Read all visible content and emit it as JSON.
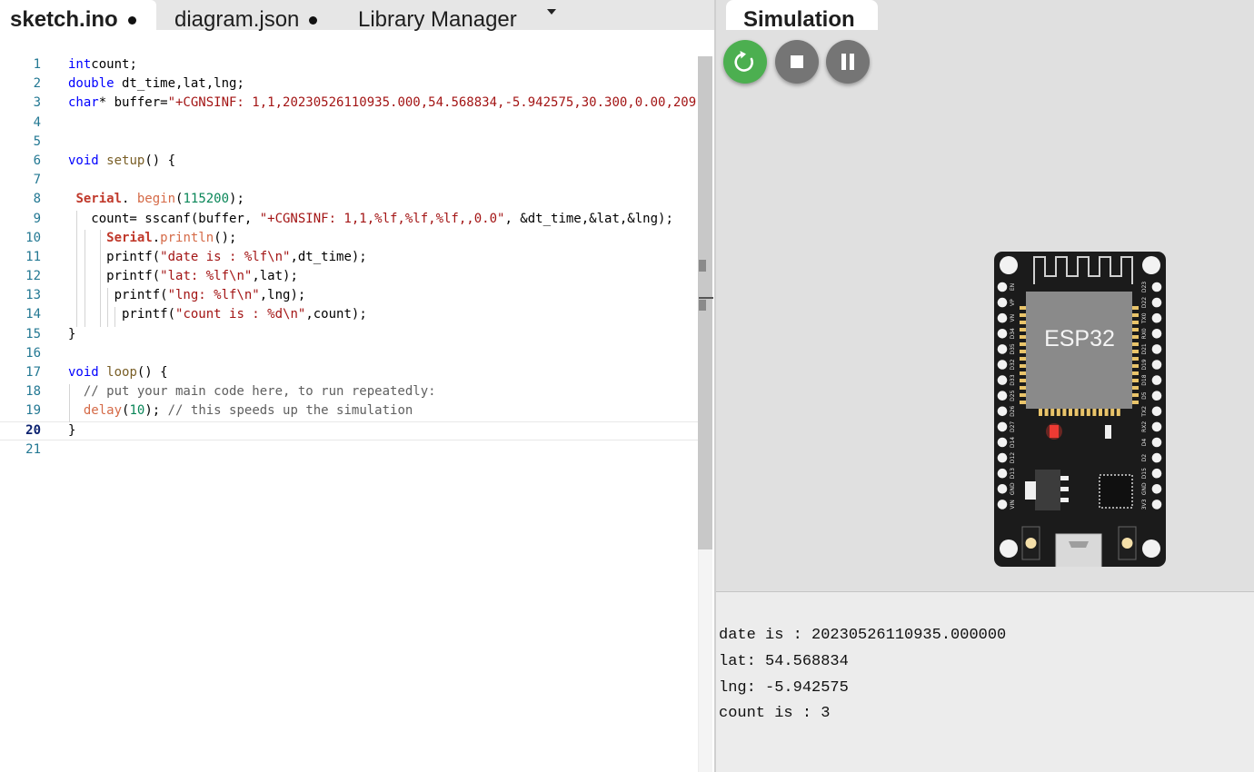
{
  "tabs": {
    "sketch": "sketch.ino",
    "diagram": "diagram.json",
    "library": "Library Manager"
  },
  "simulation": {
    "tab_label": "Simulation",
    "controls": [
      "restart-icon",
      "stop-icon",
      "pause-icon"
    ],
    "board_label": "ESP32",
    "left_pins": [
      "EN",
      "VP",
      "VN",
      "D34",
      "D35",
      "D32",
      "D33",
      "D25",
      "D26",
      "D27",
      "D14",
      "D12",
      "D13",
      "GND",
      "VIN"
    ],
    "right_pins": [
      "D23",
      "D22",
      "TX0",
      "RX0",
      "D21",
      "D19",
      "D18",
      "D5",
      "TX2",
      "RX2",
      "D4",
      "D2",
      "D15",
      "GND",
      "3V3"
    ],
    "serial_output": [
      "date is : 20230526110935.000000",
      "lat: 54.568834",
      "lng: -5.942575",
      "count is : 3"
    ]
  },
  "editor": {
    "current_line": 20,
    "lines": [
      {
        "n": "1",
        "t": [
          [
            "kw",
            "int"
          ],
          [
            "",
            "count;"
          ]
        ]
      },
      {
        "n": "2",
        "t": [
          [
            "kw",
            "double"
          ],
          [
            "",
            " dt_time,lat,lng;"
          ]
        ]
      },
      {
        "n": "3",
        "t": [
          [
            "kw",
            "char"
          ],
          [
            "",
            "* buffer="
          ],
          [
            "str",
            "\"+CGNSINF: 1,1,20230526110935.000,54.568834,-5.942575,30.300,0.00,209."
          ]
        ]
      },
      {
        "n": "4",
        "t": []
      },
      {
        "n": "5",
        "t": []
      },
      {
        "n": "6",
        "t": [
          [
            "kw",
            "void"
          ],
          [
            "",
            " "
          ],
          [
            "fn",
            "setup"
          ],
          [
            "",
            "() {"
          ]
        ]
      },
      {
        "n": "7",
        "t": []
      },
      {
        "n": "8",
        "t": [
          [
            "",
            " "
          ],
          [
            "obj",
            "Serial"
          ],
          [
            "",
            ". "
          ],
          [
            "fnc",
            "begin"
          ],
          [
            "",
            "("
          ],
          [
            "num",
            "115200"
          ],
          [
            "",
            ");"
          ]
        ]
      },
      {
        "n": "9",
        "t": [
          [
            "",
            "   count= sscanf(buffer, "
          ],
          [
            "str",
            "\"+CGNSINF: 1,1,%lf,%lf,%lf,,0.0\""
          ],
          [
            "",
            ", &dt_time,&lat,&lng);"
          ]
        ]
      },
      {
        "n": "10",
        "t": [
          [
            "",
            "     "
          ],
          [
            "obj",
            "Serial"
          ],
          [
            "",
            "."
          ],
          [
            "fnc",
            "println"
          ],
          [
            "",
            "();"
          ]
        ]
      },
      {
        "n": "11",
        "t": [
          [
            "",
            "     printf("
          ],
          [
            "str",
            "\"date is : %lf\\n\""
          ],
          [
            "",
            ",dt_time);"
          ]
        ]
      },
      {
        "n": "12",
        "t": [
          [
            "",
            "     printf("
          ],
          [
            "str",
            "\"lat: %lf\\n\""
          ],
          [
            "",
            ",lat);"
          ]
        ]
      },
      {
        "n": "13",
        "t": [
          [
            "",
            "      printf("
          ],
          [
            "str",
            "\"lng: %lf\\n\""
          ],
          [
            "",
            ",lng);"
          ]
        ]
      },
      {
        "n": "14",
        "t": [
          [
            "",
            "       printf("
          ],
          [
            "str",
            "\"count is : %d\\n\""
          ],
          [
            "",
            ",count);"
          ]
        ]
      },
      {
        "n": "15",
        "t": [
          [
            "",
            "}"
          ]
        ]
      },
      {
        "n": "16",
        "t": []
      },
      {
        "n": "17",
        "t": [
          [
            "kw",
            "void"
          ],
          [
            "",
            " "
          ],
          [
            "fn",
            "loop"
          ],
          [
            "",
            "() {"
          ]
        ]
      },
      {
        "n": "18",
        "t": [
          [
            "",
            "  "
          ],
          [
            "cmt",
            "// put your main code here, to run repeatedly:"
          ]
        ]
      },
      {
        "n": "19",
        "t": [
          [
            "",
            "  "
          ],
          [
            "fnc",
            "delay"
          ],
          [
            "",
            "("
          ],
          [
            "num",
            "10"
          ],
          [
            "",
            "); "
          ],
          [
            "cmt",
            "// this speeds up the simulation"
          ]
        ]
      },
      {
        "n": "20",
        "t": [
          [
            "",
            "}"
          ]
        ]
      },
      {
        "n": "21",
        "t": []
      }
    ]
  },
  "colors": {
    "restart_button": "#4caf50",
    "control_button": "#757575",
    "board": "#1b1b1b",
    "module": "#8a8a8a"
  }
}
